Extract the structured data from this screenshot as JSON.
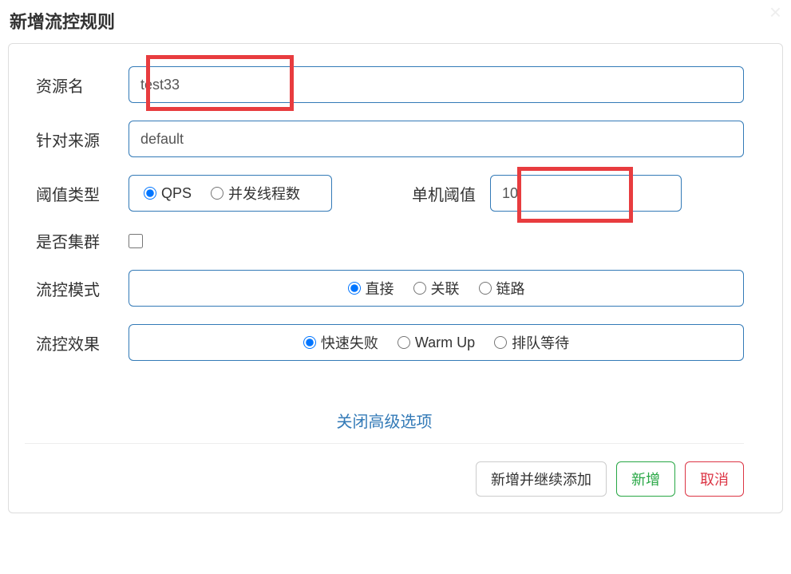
{
  "header": {
    "title": "新增流控规则",
    "close_glyph": "×"
  },
  "labels": {
    "resource": "资源名",
    "source": "针对来源",
    "threshold_type": "阈值类型",
    "single_threshold": "单机阈值",
    "is_cluster": "是否集群",
    "flow_mode": "流控模式",
    "flow_effect": "流控效果"
  },
  "inputs": {
    "resource_value": "test33",
    "source_value": "default",
    "threshold_value": "10"
  },
  "threshold_type_options": {
    "qps": "QPS",
    "threads": "并发线程数"
  },
  "flow_mode_options": {
    "direct": "直接",
    "relate": "关联",
    "chain": "链路"
  },
  "flow_effect_options": {
    "fail_fast": "快速失败",
    "warm_up": "Warm Up",
    "queue": "排队等待"
  },
  "toggle_link": "关闭高级选项",
  "footer": {
    "add_continue": "新增并继续添加",
    "add": "新增",
    "cancel": "取消"
  }
}
